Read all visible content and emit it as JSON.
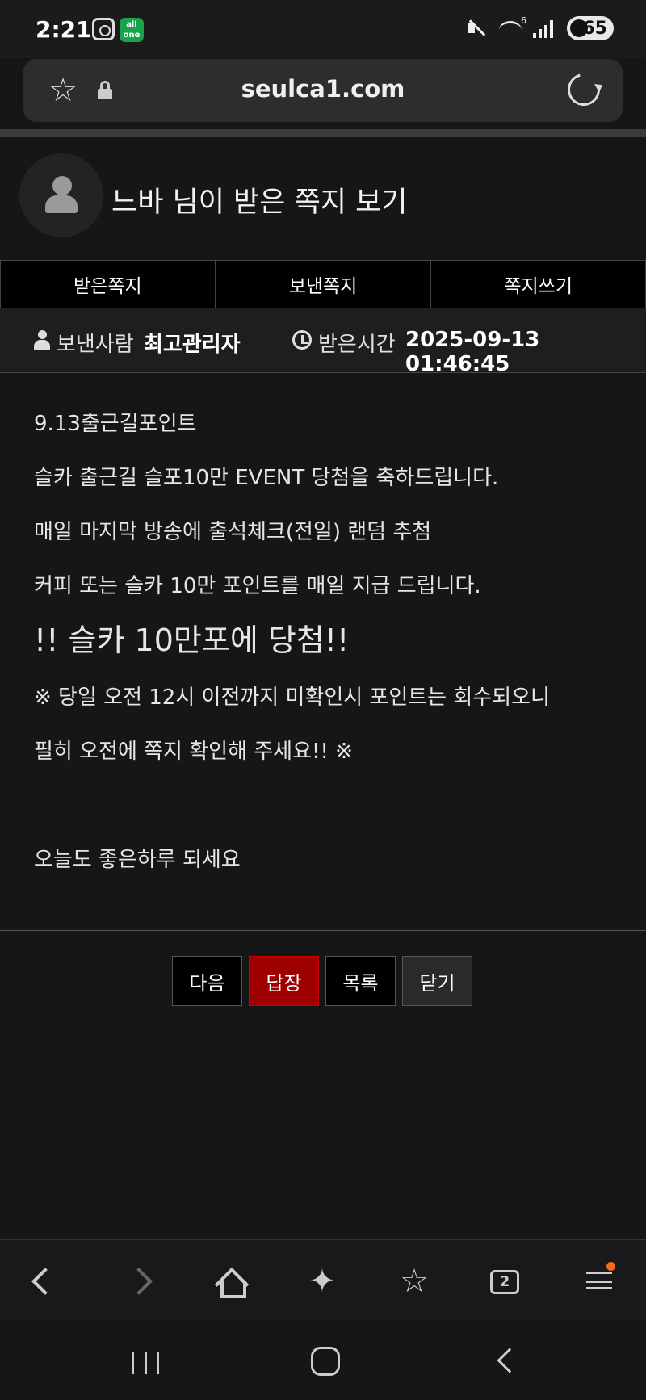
{
  "status_bar": {
    "time": "2:21",
    "app_badge": "all one",
    "battery": "65"
  },
  "browser": {
    "url": "seulca1.com",
    "tab_count": "2"
  },
  "header": {
    "title": "느바 님이 받은 쪽지 보기"
  },
  "tabs": [
    {
      "label": "받은쪽지"
    },
    {
      "label": "보낸쪽지"
    },
    {
      "label": "쪽지쓰기"
    }
  ],
  "meta": {
    "sender_label": "보낸사람",
    "sender_name": "최고관리자",
    "time_label": "받은시간",
    "time_value": "2025-09-13 01:46:45"
  },
  "message": {
    "lines": [
      "9.13출근길포인트",
      "슬카 출근길 슬포10만 EVENT 당첨을 축하드립니다.",
      "매일 마지막 방송에 출석체크(전일) 랜덤 추첨",
      "커피 또는 슬카 10만 포인트를 매일 지급 드립니다.",
      "!! 슬카 10만포에 당첨!!",
      "※ 당일 오전 12시 이전까지 미확인시 포인트는 회수되오니",
      "필히 오전에 쪽지 확인해 주세요!! ※",
      "",
      "오늘도 좋은하루 되세요"
    ]
  },
  "actions": {
    "next": "다음",
    "reply": "답장",
    "list": "목록",
    "close": "닫기"
  },
  "colors": {
    "background": "#161618",
    "reply_button": "#9e0000",
    "notification_dot": "#f26b21"
  }
}
